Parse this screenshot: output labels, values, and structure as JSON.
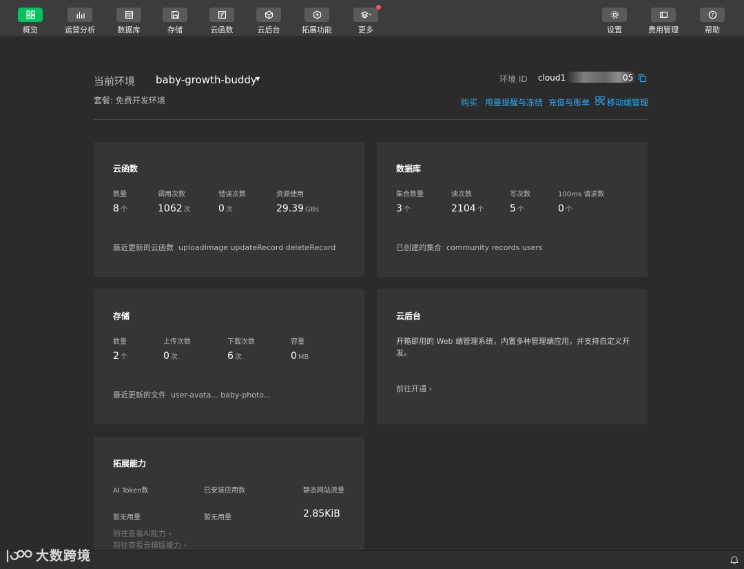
{
  "toolbar": {
    "left_items": [
      {
        "label": "概览",
        "icon": "grid-icon",
        "active": true
      },
      {
        "label": "运营分析",
        "icon": "bar-chart-icon"
      },
      {
        "label": "数据库",
        "icon": "database-icon"
      },
      {
        "label": "存储",
        "icon": "save-icon"
      },
      {
        "label": "云函数",
        "icon": "function-icon"
      },
      {
        "label": "云后台",
        "icon": "cube-icon"
      },
      {
        "label": "拓展功能",
        "icon": "extension-icon"
      },
      {
        "label": "更多",
        "icon": "layers-icon",
        "badge": true
      }
    ],
    "right_items": [
      {
        "label": "设置",
        "icon": "gear-icon"
      },
      {
        "label": "费用管理",
        "icon": "billing-icon"
      },
      {
        "label": "帮助",
        "icon": "help-icon"
      }
    ]
  },
  "env": {
    "label": "当前环境",
    "name": "baby-growth-buddy",
    "plan": "套餐: 免费开发环境",
    "id_label": "环境 ID",
    "id_value": "cloud1",
    "id_suffix": "05",
    "links": {
      "buy": "购买",
      "usage": "用量提醒与冻结",
      "recharge": "充值与账单",
      "mobile": "移动端管理"
    }
  },
  "cloud_functions": {
    "title": "云函数",
    "stats": [
      {
        "label": "数量",
        "value": "8",
        "unit": "个"
      },
      {
        "label": "调用次数",
        "value": "1062",
        "unit": "次"
      },
      {
        "label": "错误次数",
        "value": "0",
        "unit": "次"
      },
      {
        "label": "资源使用",
        "value": "29.39",
        "unit": "GBs"
      }
    ],
    "footer_label": "最近更新的云函数",
    "footer_value": "uploadImage  updateRecord  deleteRecord"
  },
  "database": {
    "title": "数据库",
    "stats": [
      {
        "label": "集合数量",
        "value": "3",
        "unit": "个"
      },
      {
        "label": "读次数",
        "value": "2104",
        "unit": "个"
      },
      {
        "label": "写次数",
        "value": "5",
        "unit": "个"
      },
      {
        "label": "100ms 请求数",
        "value": "0",
        "unit": "个"
      }
    ],
    "footer_label": "已创建的集合",
    "footer_value": "community  records  users"
  },
  "storage": {
    "title": "存储",
    "stats": [
      {
        "label": "数量",
        "value": "2",
        "unit": "个"
      },
      {
        "label": "上传次数",
        "value": "0",
        "unit": "次"
      },
      {
        "label": "下载次数",
        "value": "6",
        "unit": "次"
      },
      {
        "label": "容量",
        "value": "0",
        "unit": "MB"
      }
    ],
    "footer_label": "最近更新的文件",
    "footer_value": "user-avata...  baby-photo..."
  },
  "cloud_admin": {
    "title": "云后台",
    "description": "开箱即用的 Web 端管理系统，内置多种管理端应用，并支持自定义开发。",
    "link": "前往开通"
  },
  "extensions": {
    "title": "拓展能力",
    "stats": [
      {
        "label": "AI Token数",
        "value": "暂无用量"
      },
      {
        "label": "已安装应用数",
        "value": "暂无用量"
      },
      {
        "label": "静态网站流量",
        "value": "2.85KiB"
      }
    ],
    "link_ai": "前往查看AI能力",
    "link_template": "前往查看云模版能力"
  },
  "watermark": {
    "text": "大数跨境"
  }
}
